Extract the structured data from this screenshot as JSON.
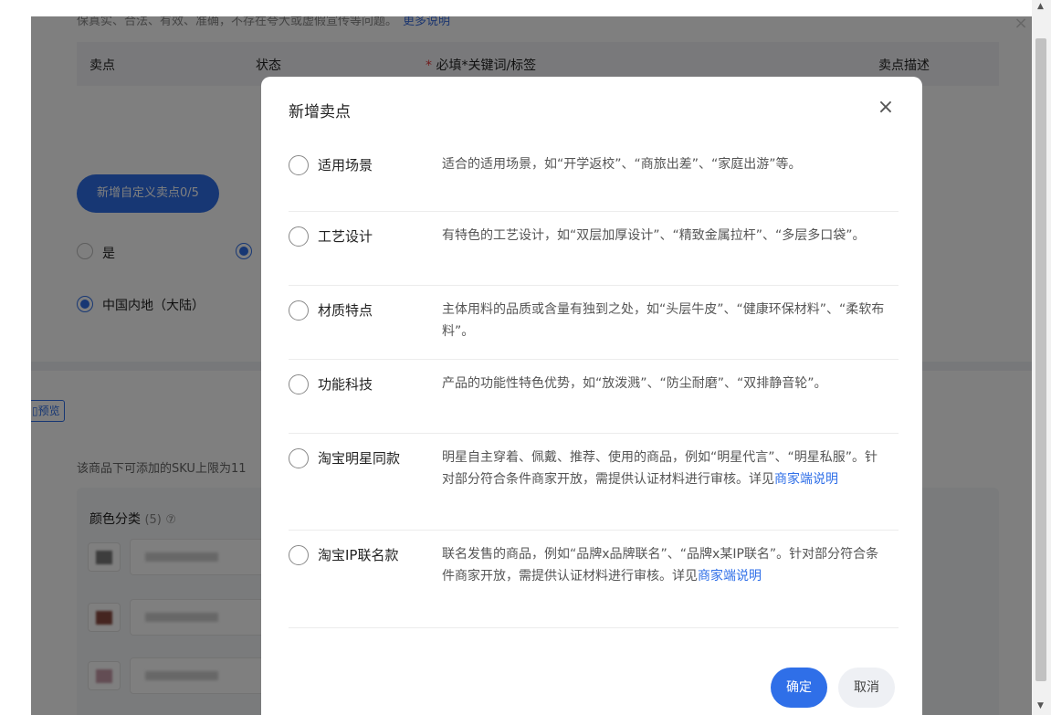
{
  "background": {
    "top_note": "保真实、合法、有效、准确，不存在夸大或虚假宣传等问题。",
    "top_note_link": "更多说明",
    "table_headers": {
      "col1": "卖点",
      "col2": "状态",
      "col3_required_mark": "*",
      "col3": "必填*关键词/标签",
      "col4": "卖点描述"
    },
    "add_custom_button": "新增自定义卖点0/5",
    "radio_yes_label": "是",
    "region_label": "中国内地（大陆）",
    "preview_button": "预览",
    "sku_note": "该商品下可添加的SKU上限为11",
    "color_section_title": "颜色分类",
    "color_count": "(5)",
    "help_icon_glyph": "⑦"
  },
  "outer_close_glyph": "×",
  "modal": {
    "title": "新增卖点",
    "close_glyph": "×",
    "options": [
      {
        "label": "适用场景",
        "description": "适合的适用场景，如“开学返校”、“商旅出差”、“家庭出游”等。",
        "link": ""
      },
      {
        "label": "工艺设计",
        "description": "有特色的工艺设计，如“双层加厚设计”、“精致金属拉杆”、“多层多口袋”。",
        "link": ""
      },
      {
        "label": "材质特点",
        "description": "主体用料的品质或含量有独到之处，如“头层牛皮”、“健康环保材料”、“柔软布料”。",
        "link": ""
      },
      {
        "label": "功能科技",
        "description": "产品的功能性特色优势，如“放泼溅”、“防尘耐磨”、“双排静音轮”。",
        "link": ""
      },
      {
        "label": "淘宝明星同款",
        "description": "明星自主穿着、佩戴、推荐、使用的商品，例如“明星代言”、“明星私服”。针对部分符合条件商家开放，需提供认证材料进行审核。详见",
        "link": "商家端说明"
      },
      {
        "label": "淘宝IP联名款",
        "description": "联名发售的商品，例如“品牌x品牌联名”、“品牌x某IP联名”。针对部分符合条件商家开放，需提供认证材料进行审核。详见",
        "link": "商家端说明"
      }
    ],
    "confirm_button": "确定",
    "cancel_button": "取消"
  },
  "colors": {
    "primary": "#2f6fe8",
    "overlay": "rgba(0,0,0,0.5)",
    "required": "#e4393c"
  }
}
